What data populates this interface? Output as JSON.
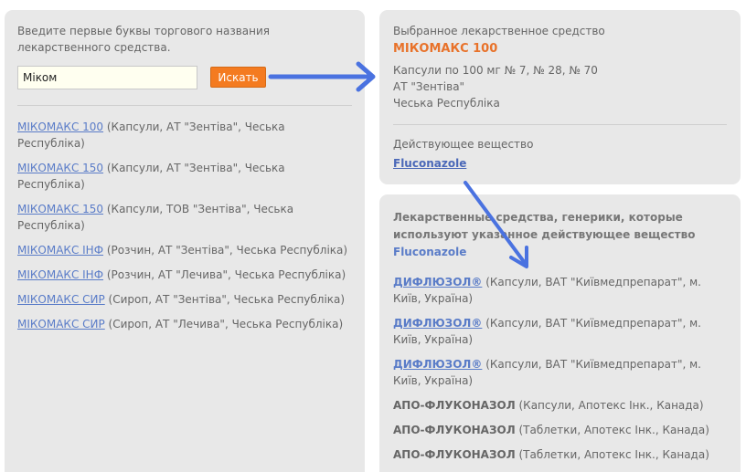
{
  "search": {
    "intro": "Введите первые буквы торгового названия лекарственного средства.",
    "value": "Міком",
    "button_label": "Искать"
  },
  "results": [
    {
      "name": "МІКОМАКС 100",
      "details": " (Капсули, АТ \"Зентіва\", Чеська Республіка)"
    },
    {
      "name": "МІКОМАКС 150",
      "details": " (Капсули, АТ \"Зентіва\", Чеська Республіка)"
    },
    {
      "name": "МІКОМАКС 150",
      "details": " (Капсули, ТОВ \"Зентіва\", Чеська Республіка)"
    },
    {
      "name": "МІКОМАКС ІНФ",
      "details": " (Розчин, АТ \"Зентіва\", Чеська Республіка)"
    },
    {
      "name": "МІКОМАКС ІНФ",
      "details": " (Розчин, АТ \"Лечива\", Чеська Республіка)"
    },
    {
      "name": "МІКОМАКС СИР",
      "details": " (Сироп, АТ \"Зентіва\", Чеська Республіка)"
    },
    {
      "name": "МІКОМАКС СИР",
      "details": " (Сироп, АТ \"Лечива\", Чеська Республіка)"
    }
  ],
  "selected": {
    "label": "Выбранное лекарственное средство",
    "name": "МІКОМАКС 100",
    "details": [
      "Капсули по 100 мг № 7, № 28, № 70",
      "АТ \"Зентіва\"",
      "Чеська Республіка"
    ],
    "active_label": "Действующее вещество",
    "active_substance": "Fluconazole"
  },
  "generics": {
    "title": "Лекарственные средства, генерики, которые используют указанное действующее вещество",
    "substance": "Fluconazole",
    "items": [
      {
        "name": "ДИФЛЮЗОЛ®",
        "details": " (Капсули, ВАТ \"Київмедпрепарат\", м. Київ, Україна)",
        "linked": true
      },
      {
        "name": "ДИФЛЮЗОЛ®",
        "details": " (Капсули, ВАТ \"Київмедпрепарат\", м. Київ, Україна)",
        "linked": true
      },
      {
        "name": "ДИФЛЮЗОЛ®",
        "details": " (Капсули, ВАТ \"Київмедпрепарат\", м. Київ, Україна)",
        "linked": true
      },
      {
        "name": "АПО-ФЛУКОНАЗОЛ",
        "details": " (Капсули, Апотекс Інк., Канада)",
        "linked": false
      },
      {
        "name": "АПО-ФЛУКОНАЗОЛ",
        "details": " (Таблетки, Апотекс Інк., Канада)",
        "linked": false
      },
      {
        "name": "АПО-ФЛУКОНАЗОЛ",
        "details": " (Таблетки, Апотекс Інк., Канада)",
        "linked": false
      }
    ]
  },
  "colors": {
    "panel": "#e8e8e8",
    "accent_orange": "#f47b20",
    "link_blue": "#5a7cc8",
    "arrow_blue": "#4a72e0"
  },
  "icons": {
    "arrow_right": "arrow-right-icon",
    "arrow_down": "arrow-down-icon"
  }
}
